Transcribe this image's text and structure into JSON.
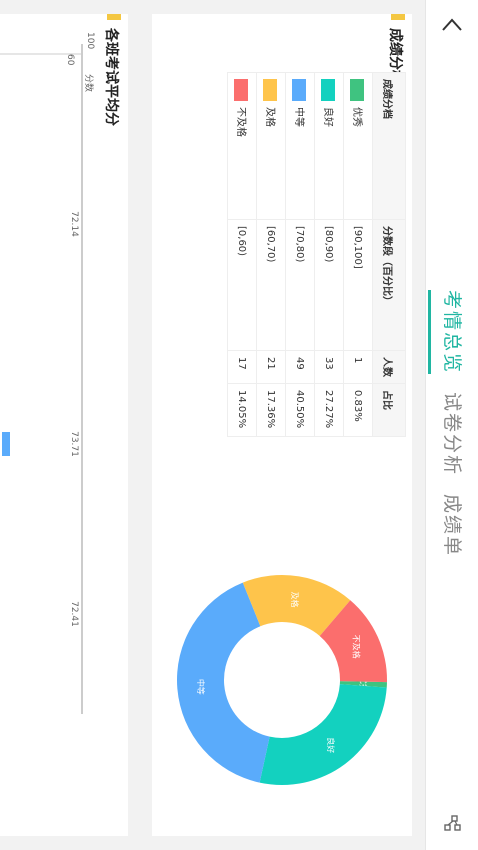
{
  "header": {
    "tabs": [
      {
        "label": "考情总览",
        "active": true
      },
      {
        "label": "试卷分析",
        "active": false
      },
      {
        "label": "成绩单",
        "active": false
      }
    ]
  },
  "grade_stats": {
    "title": "成绩分档统计",
    "columns": [
      "成绩分档",
      "分数段（百分比）",
      "人数",
      "占比"
    ],
    "rows": [
      {
        "level": "优秀",
        "range": "[90,100]",
        "count": "1",
        "ratio": "0.83%",
        "color": "#3fc380"
      },
      {
        "level": "良好",
        "range": "[80,90)",
        "count": "33",
        "ratio": "27.27%",
        "color": "#13d1bf"
      },
      {
        "level": "中等",
        "range": "[70,80)",
        "count": "49",
        "ratio": "40.50%",
        "color": "#5aabfb"
      },
      {
        "level": "及格",
        "range": "[60,70)",
        "count": "21",
        "ratio": "17.36%",
        "color": "#fec44b"
      },
      {
        "level": "不及格",
        "range": "[0,60)",
        "count": "17",
        "ratio": "14.05%",
        "color": "#fb6e6d"
      }
    ]
  },
  "chart_data": [
    {
      "type": "pie",
      "labels": [
        "优秀",
        "良好",
        "中等",
        "及格",
        "不及格"
      ],
      "values": [
        1,
        33,
        49,
        21,
        17
      ],
      "colors": [
        "#3fc380",
        "#13d1bf",
        "#5aabfb",
        "#fec44b",
        "#fb6e6d"
      ]
    },
    {
      "type": "bar",
      "title": "各班考试平均分",
      "ylabel": "分数",
      "ylim": [
        60,
        100
      ],
      "yticks": [
        "60",
        "100"
      ],
      "values": [
        72.14,
        73.71,
        72.41
      ],
      "value_labels": [
        "72.14",
        "73.71",
        "72.41"
      ]
    }
  ]
}
